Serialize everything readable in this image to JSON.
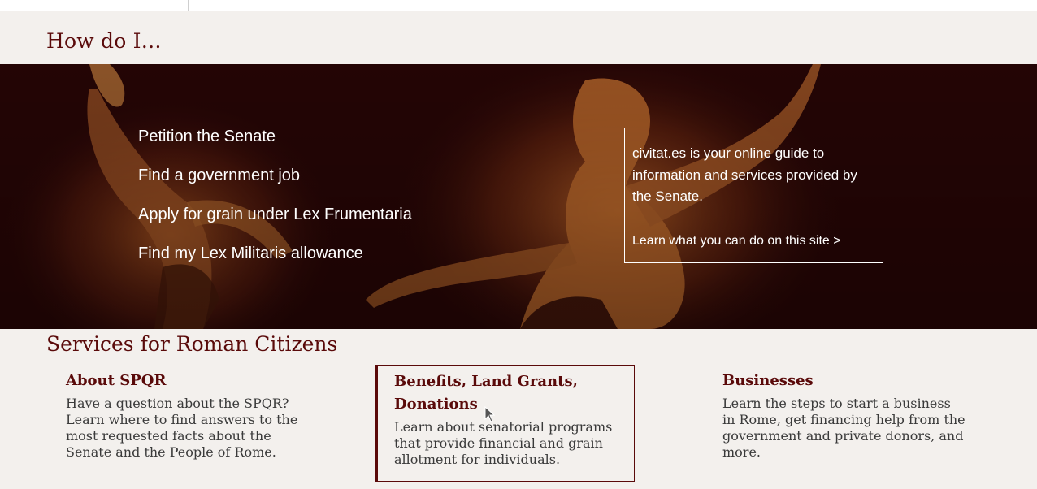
{
  "how_do_i": {
    "title": "How do I…",
    "links": [
      "Petition the Senate",
      "Find a government job",
      "Apply for grain under Lex Frumentaria",
      "Find my Lex Militaris allowance"
    ],
    "info_text": "civitat.es is your online guide to information and services provided by the Senate.",
    "info_link": "Learn what you can do on this site >"
  },
  "services": {
    "title": "Services for Roman Citizens",
    "cards": [
      {
        "title": "About SPQR",
        "description": "Have a question about the SPQR? Learn where to find answers to the most requested facts about the Senate and the People of Rome."
      },
      {
        "title": "Benefits, Land Grants, Donations",
        "description": "Learn about senatorial programs that provide financial and grain allotment for individuals."
      },
      {
        "title": "Businesses",
        "description": "Learn the steps to start a business in Rome, get financing help from the government and private donors, and more."
      }
    ]
  },
  "colors": {
    "brand": "#5a0a0a",
    "hero_bg": "#2a0505",
    "page_bg": "#f3f0ed"
  },
  "icons": [
    "mouse-pointer-icon"
  ]
}
